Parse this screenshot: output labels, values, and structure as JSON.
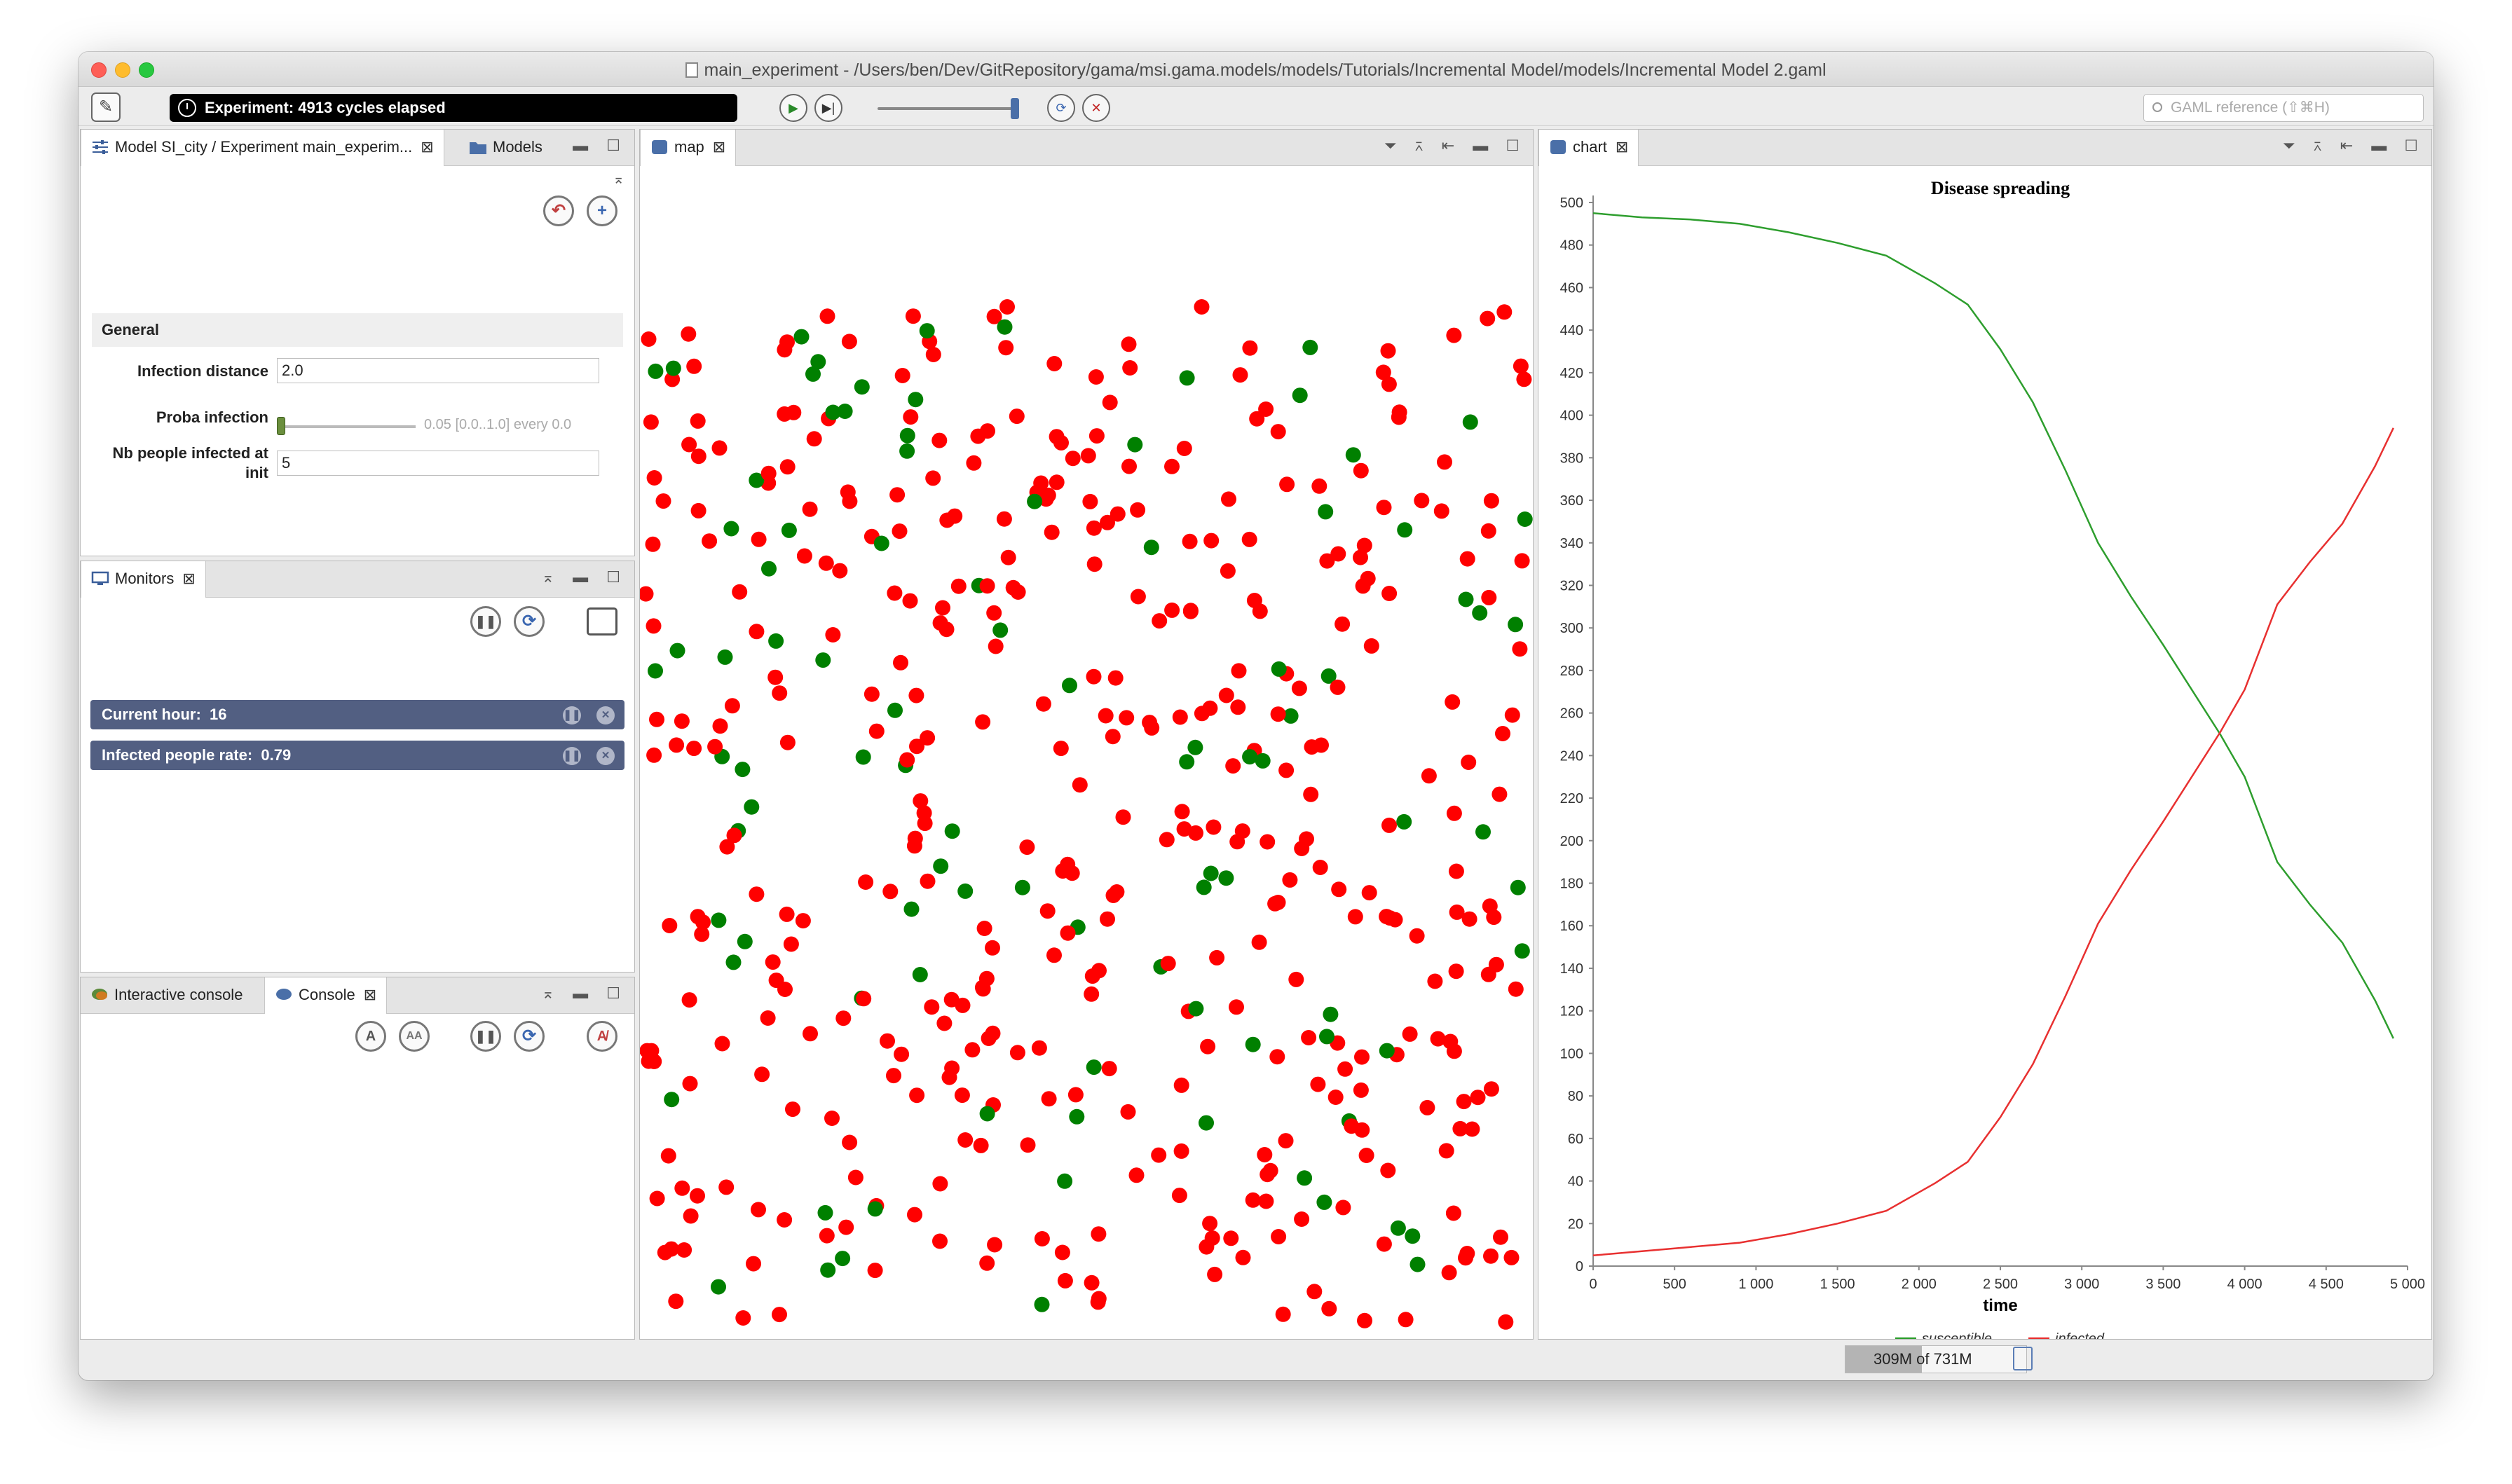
{
  "window": {
    "title": "main_experiment - /Users/ben/Dev/GitRepository/gama/msi.gama.models/models/Tutorials/Incremental Model/models/Incremental Model 2.gaml"
  },
  "toolbar": {
    "status": "Experiment: 4913 cycles elapsed",
    "search_placeholder": "GAML reference (⇧⌘H)",
    "icons": [
      "edit-icon",
      "clock-icon",
      "play-icon",
      "step-icon",
      "reload-icon",
      "close-icon"
    ]
  },
  "params_panel": {
    "tab_label": "Model SI_city / Experiment main_experim...",
    "models_tab": "Models",
    "section": "General",
    "params": [
      {
        "label": "Infection distance",
        "value": "2.0"
      },
      {
        "label": "Proba infection",
        "value": "0.05 [0.0..1.0] every 0.0"
      },
      {
        "label": "Nb people infected at init",
        "value": "5"
      }
    ],
    "proba_level": 0.05
  },
  "monitors_panel": {
    "tab_label": "Monitors",
    "monitors": [
      {
        "label": "Current hour:",
        "value": "16"
      },
      {
        "label": "Infected people rate:",
        "value": "0.79"
      }
    ]
  },
  "console_panel": {
    "tab_interactive": "Interactive console",
    "tab_console": "Console"
  },
  "map_panel": {
    "tab_label": "map",
    "colors": {
      "infected": "#ff0000",
      "susceptible": "#008000"
    }
  },
  "chart_panel": {
    "tab_label": "chart"
  },
  "memory": {
    "text": "309M of 731M",
    "used_fraction": 0.423
  },
  "chart_data": {
    "type": "line",
    "title": "Disease spreading",
    "xlabel": "time",
    "ylabel": "",
    "xlim": [
      0,
      5000
    ],
    "ylim": [
      0,
      500
    ],
    "xticks": [
      "0",
      "500",
      "1 000",
      "1 500",
      "2 000",
      "2 500",
      "3 000",
      "3 500",
      "4 000",
      "4 500",
      "5 000"
    ],
    "yticks": [
      "0",
      "20",
      "40",
      "60",
      "80",
      "100",
      "120",
      "140",
      "160",
      "180",
      "200",
      "220",
      "240",
      "260",
      "280",
      "300",
      "320",
      "340",
      "360",
      "380",
      "400",
      "420",
      "440",
      "460",
      "480",
      "500"
    ],
    "legend_position": "bottom",
    "series": [
      {
        "name": "susceptible",
        "color": "#2e9e2e",
        "x": [
          0,
          300,
          600,
          900,
          1200,
          1500,
          1800,
          2100,
          2300,
          2500,
          2700,
          2900,
          3100,
          3300,
          3500,
          3700,
          3850,
          4000,
          4200,
          4400,
          4600,
          4800,
          4913
        ],
        "y": [
          495,
          493,
          492,
          490,
          486,
          481,
          475,
          462,
          452,
          431,
          406,
          374,
          340,
          315,
          292,
          268,
          250,
          230,
          190,
          170,
          152,
          125,
          107
        ]
      },
      {
        "name": "infected",
        "color": "#e83030",
        "x": [
          0,
          300,
          600,
          900,
          1200,
          1500,
          1800,
          2100,
          2300,
          2500,
          2700,
          2900,
          3100,
          3300,
          3500,
          3700,
          3850,
          4000,
          4200,
          4400,
          4600,
          4800,
          4913
        ],
        "y": [
          5,
          7,
          9,
          11,
          15,
          20,
          26,
          39,
          49,
          70,
          95,
          127,
          161,
          186,
          209,
          233,
          251,
          271,
          311,
          331,
          349,
          376,
          394
        ]
      }
    ]
  }
}
